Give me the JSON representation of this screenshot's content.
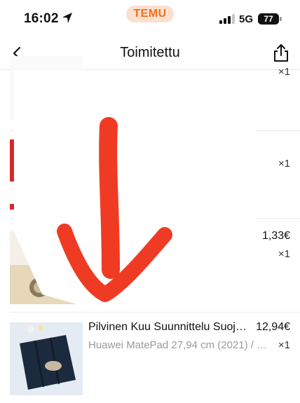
{
  "status_bar": {
    "time": "16:02",
    "app_badge": "TEMU",
    "network": "5G",
    "battery": "77"
  },
  "nav": {
    "title": "Toimitettu"
  },
  "items": [
    {
      "name": "",
      "variant": "",
      "price": "",
      "qty": "×1"
    },
    {
      "name": "",
      "variant": "",
      "price": "",
      "qty": "×1"
    },
    {
      "name": "",
      "variant": "",
      "price": "1,33€",
      "qty": "×1"
    },
    {
      "name": "Pilvinen Kuu Suunnittelu Suojak...",
      "variant": "Huawei MatePad 27,94 cm (2021) / U...",
      "price": "12,94€",
      "qty": "×1"
    }
  ],
  "colors": {
    "temu_orange": "#f36f1c",
    "temu_pill_bg": "#fbe0cf",
    "annotation_red": "#ef3b24"
  }
}
